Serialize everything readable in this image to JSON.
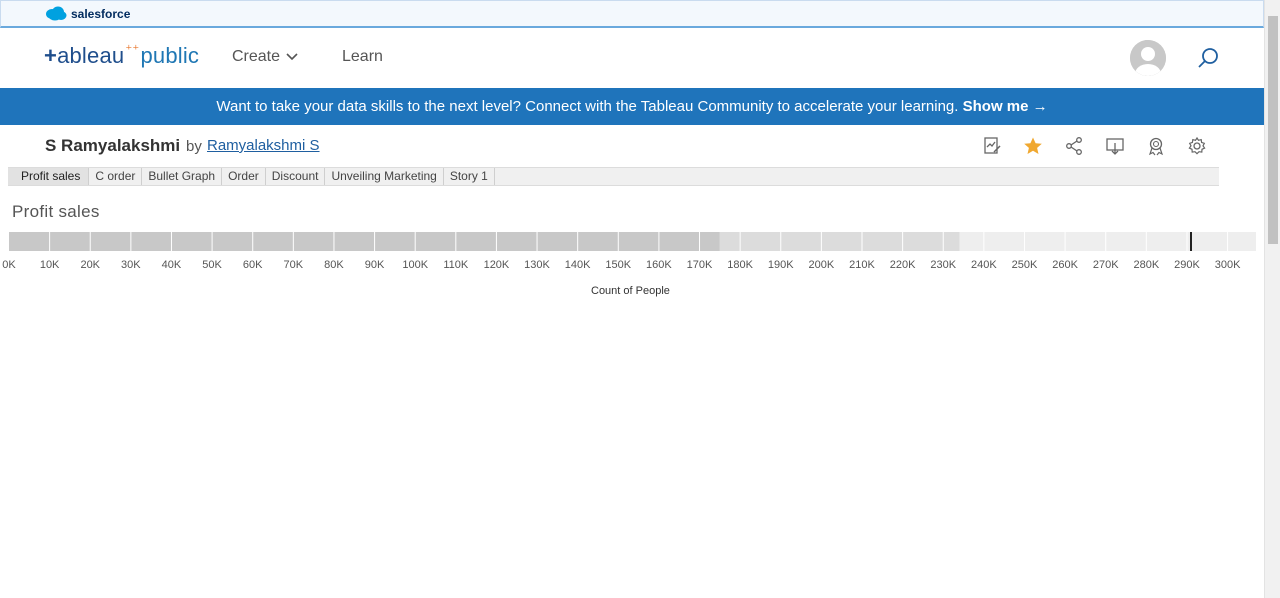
{
  "salesforce": {
    "brand": "salesforce"
  },
  "header": {
    "nav": {
      "create": "Create",
      "learn": "Learn"
    }
  },
  "banner": {
    "text": "Want to take your data skills to the next level? Connect with the Tableau Community to accelerate your learning.",
    "cta": "Show me →"
  },
  "viz": {
    "title": "S Ramyalakshmi",
    "by": "by",
    "author": "Ramyalakshmi S",
    "toolbar": [
      "edit-icon",
      "favorite-star-icon",
      "share-icon",
      "download-icon",
      "badge-icon",
      "settings-icon"
    ]
  },
  "tabs": [
    "Profit sales",
    "C order",
    "Bullet Graph",
    "Order",
    "Discount",
    "Unveiling Marketing",
    "Story 1"
  ],
  "active_tab": 0,
  "sheet": {
    "title": "Profit sales"
  },
  "chart_data": {
    "type": "bar",
    "orientation": "horizontal",
    "subtype": "bullet",
    "xlabel": "Count of People",
    "xlim": [
      0,
      307000
    ],
    "tick_labels": [
      "0K",
      "10K",
      "20K",
      "30K",
      "40K",
      "50K",
      "60K",
      "70K",
      "80K",
      "90K",
      "100K",
      "110K",
      "120K",
      "130K",
      "140K",
      "150K",
      "160K",
      "170K",
      "180K",
      "190K",
      "200K",
      "210K",
      "220K",
      "230K",
      "240K",
      "250K",
      "260K",
      "270K",
      "280K",
      "290K",
      "300K"
    ],
    "bands": [
      {
        "from": 0,
        "to": 175000,
        "color": "#c8c8c8"
      },
      {
        "from": 175000,
        "to": 234000,
        "color": "#dcdcdc"
      },
      {
        "from": 234000,
        "to": 307000,
        "color": "#eeeeee"
      }
    ],
    "reference_line": 291000,
    "grid": true
  },
  "colors": {
    "brand_blue": "#1f74bb",
    "star": "#f0a830"
  }
}
